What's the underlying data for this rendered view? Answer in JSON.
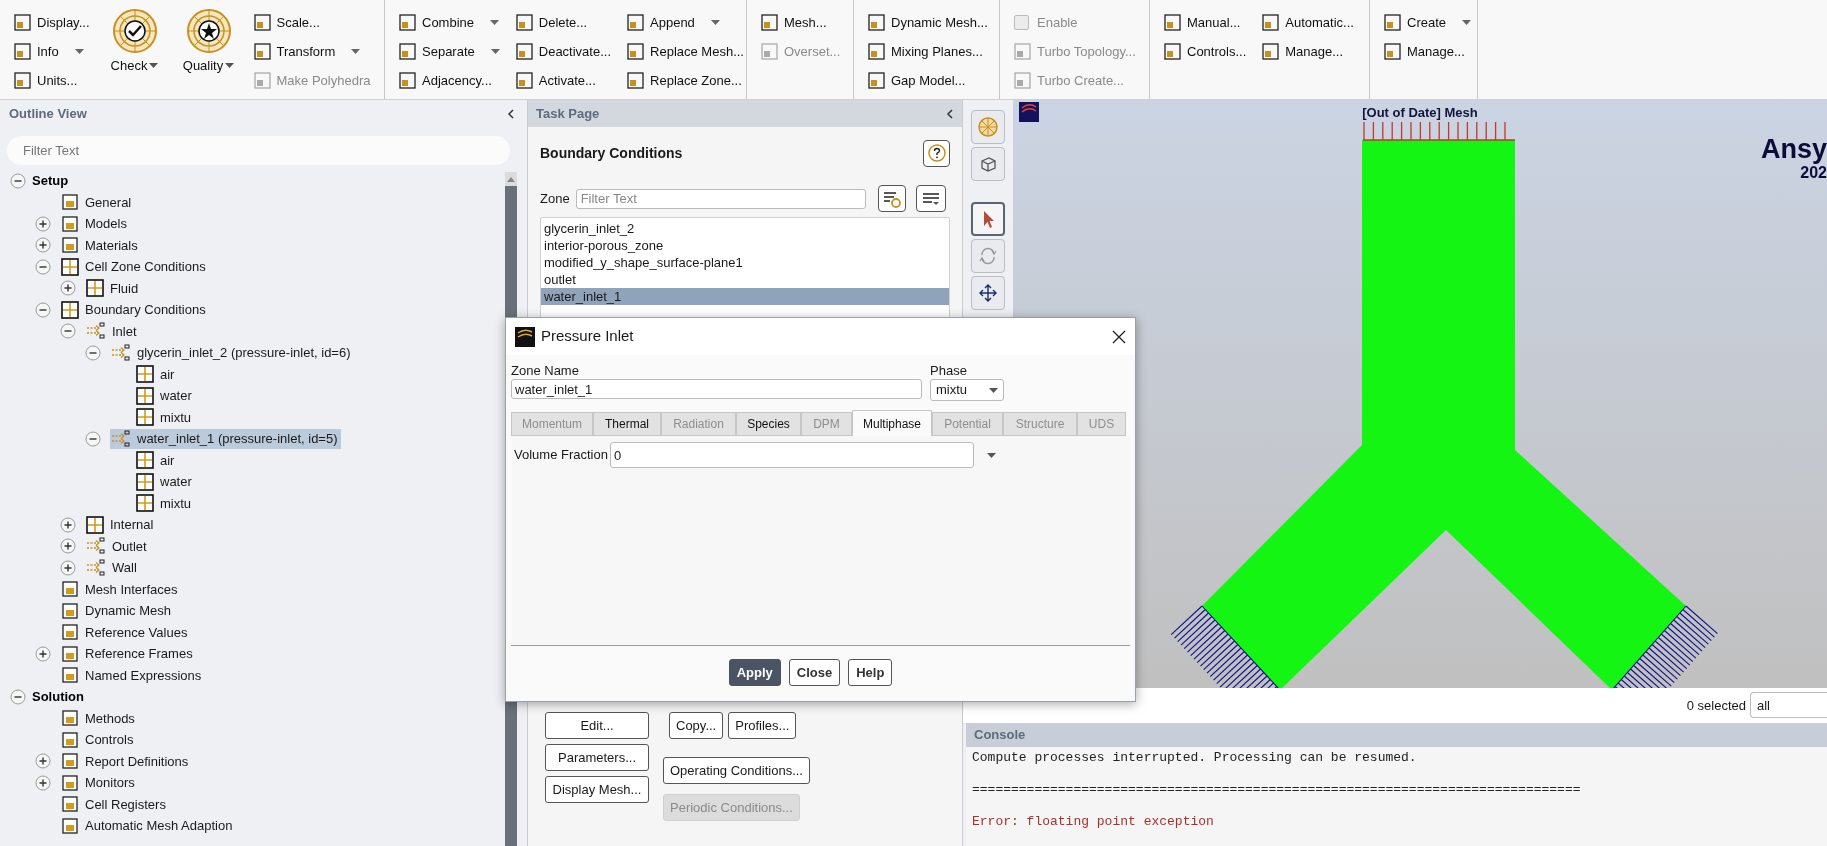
{
  "ribbon": [
    {
      "columns": [
        [
          {
            "kind": "small",
            "label": "Display...",
            "dropdown": false,
            "disabled": false
          },
          {
            "kind": "small",
            "label": "Info",
            "dropdown": true,
            "disabled": false
          },
          {
            "kind": "small",
            "label": "Units...",
            "dropdown": false,
            "disabled": false
          }
        ],
        [
          {
            "kind": "large",
            "label": "Check",
            "dropdown": true,
            "disabled": false
          }
        ],
        [
          {
            "kind": "large",
            "label": "Quality",
            "dropdown": true,
            "disabled": false
          }
        ],
        [
          {
            "kind": "small",
            "label": "Scale...",
            "dropdown": false,
            "disabled": false
          },
          {
            "kind": "small",
            "label": "Transform",
            "dropdown": true,
            "disabled": false
          },
          {
            "kind": "small",
            "label": "Make Polyhedra",
            "dropdown": false,
            "disabled": true
          }
        ]
      ]
    },
    {
      "columns": [
        [
          {
            "kind": "small",
            "label": "Combine",
            "dropdown": true,
            "disabled": false
          },
          {
            "kind": "small",
            "label": "Separate",
            "dropdown": true,
            "disabled": false
          },
          {
            "kind": "small",
            "label": "Adjacency...",
            "dropdown": false,
            "disabled": false
          }
        ],
        [
          {
            "kind": "small",
            "label": "Delete...",
            "dropdown": false,
            "disabled": false
          },
          {
            "kind": "small",
            "label": "Deactivate...",
            "dropdown": false,
            "disabled": false
          },
          {
            "kind": "small",
            "label": "Activate...",
            "dropdown": false,
            "disabled": false
          }
        ],
        [
          {
            "kind": "small",
            "label": "Append",
            "dropdown": true,
            "disabled": false
          },
          {
            "kind": "small",
            "label": "Replace Mesh...",
            "dropdown": false,
            "disabled": false
          },
          {
            "kind": "small",
            "label": "Replace Zone...",
            "dropdown": false,
            "disabled": false
          }
        ]
      ]
    },
    {
      "columns": [
        [
          {
            "kind": "small",
            "label": "Mesh...",
            "dropdown": false,
            "disabled": false
          },
          {
            "kind": "small",
            "label": "Overset...",
            "dropdown": false,
            "disabled": true
          }
        ]
      ]
    },
    {
      "columns": [
        [
          {
            "kind": "small",
            "label": "Dynamic Mesh...",
            "dropdown": false,
            "disabled": false
          },
          {
            "kind": "small",
            "label": "Mixing Planes...",
            "dropdown": false,
            "disabled": false
          },
          {
            "kind": "small",
            "label": "Gap Model...",
            "dropdown": false,
            "disabled": false
          }
        ]
      ]
    },
    {
      "columns": [
        [
          {
            "kind": "checkbox",
            "label": "Enable",
            "checked": false,
            "disabled": true
          },
          {
            "kind": "small",
            "label": "Turbo Topology...",
            "dropdown": false,
            "disabled": true
          },
          {
            "kind": "small",
            "label": "Turbo Create...",
            "dropdown": false,
            "disabled": true
          }
        ]
      ]
    },
    {
      "columns": [
        [
          {
            "kind": "small",
            "label": "Manual...",
            "dropdown": false,
            "disabled": false
          },
          {
            "kind": "small",
            "label": "Controls...",
            "dropdown": false,
            "disabled": false
          }
        ],
        [
          {
            "kind": "small",
            "label": "Automatic...",
            "dropdown": false,
            "disabled": false
          },
          {
            "kind": "small",
            "label": "Manage...",
            "dropdown": false,
            "disabled": false
          }
        ]
      ]
    },
    {
      "columns": [
        [
          {
            "kind": "small",
            "label": "Create",
            "dropdown": true,
            "disabled": false
          },
          {
            "kind": "small",
            "label": "Manage...",
            "dropdown": false,
            "disabled": false
          }
        ]
      ]
    }
  ],
  "outline": {
    "title": "Outline View",
    "filter_placeholder": "Filter Text",
    "tree": [
      {
        "label": "Setup",
        "kind": "section",
        "expanded": true,
        "selected": false,
        "children": [
          {
            "label": "General",
            "kind": "item",
            "selected": false
          },
          {
            "label": "Models",
            "kind": "item",
            "expanded": false,
            "selected": false
          },
          {
            "label": "Materials",
            "kind": "item",
            "expanded": false,
            "selected": false
          },
          {
            "label": "Cell Zone Conditions",
            "kind": "zone",
            "expanded": true,
            "selected": false,
            "children": [
              {
                "label": "Fluid",
                "kind": "zone",
                "expanded": false,
                "selected": false
              }
            ]
          },
          {
            "label": "Boundary Conditions",
            "kind": "zone",
            "expanded": true,
            "selected": false,
            "children": [
              {
                "label": "Inlet",
                "kind": "flow",
                "expanded": true,
                "selected": false,
                "children": [
                  {
                    "label": "glycerin_inlet_2 (pressure-inlet, id=6)",
                    "kind": "flow",
                    "expanded": true,
                    "selected": false,
                    "children": [
                      {
                        "label": "air",
                        "kind": "zone",
                        "selected": false
                      },
                      {
                        "label": "water",
                        "kind": "zone",
                        "selected": false
                      },
                      {
                        "label": "mixtu",
                        "kind": "zone",
                        "selected": false
                      }
                    ]
                  },
                  {
                    "label": "water_inlet_1 (pressure-inlet, id=5)",
                    "kind": "flow",
                    "expanded": true,
                    "selected": true,
                    "children": [
                      {
                        "label": "air",
                        "kind": "zone",
                        "selected": false
                      },
                      {
                        "label": "water",
                        "kind": "zone",
                        "selected": false
                      },
                      {
                        "label": "mixtu",
                        "kind": "zone",
                        "selected": false
                      }
                    ]
                  }
                ]
              },
              {
                "label": "Internal",
                "kind": "zone",
                "expanded": false,
                "selected": false
              },
              {
                "label": "Outlet",
                "kind": "flow",
                "expanded": false,
                "selected": false
              },
              {
                "label": "Wall",
                "kind": "flow",
                "expanded": false,
                "selected": false
              }
            ]
          },
          {
            "label": "Mesh Interfaces",
            "kind": "item",
            "selected": false
          },
          {
            "label": "Dynamic Mesh",
            "kind": "item",
            "selected": false
          },
          {
            "label": "Reference Values",
            "kind": "item",
            "selected": false
          },
          {
            "label": "Reference Frames",
            "kind": "item",
            "expanded": false,
            "selected": false
          },
          {
            "label": "Named Expressions",
            "kind": "item",
            "selected": false
          }
        ]
      },
      {
        "label": "Solution",
        "kind": "section",
        "expanded": true,
        "selected": false,
        "children": [
          {
            "label": "Methods",
            "kind": "item",
            "selected": false
          },
          {
            "label": "Controls",
            "kind": "item",
            "selected": false
          },
          {
            "label": "Report Definitions",
            "kind": "item",
            "expanded": false,
            "selected": false
          },
          {
            "label": "Monitors",
            "kind": "item",
            "expanded": false,
            "selected": false
          },
          {
            "label": "Cell Registers",
            "kind": "item",
            "selected": false
          },
          {
            "label": "Automatic Mesh Adaption",
            "kind": "item",
            "selected": false
          }
        ]
      }
    ]
  },
  "task_page": {
    "header": "Task Page",
    "title": "Boundary Conditions",
    "zone_label": "Zone",
    "zone_filter_placeholder": "Filter Text",
    "zones": [
      {
        "label": "glycerin_inlet_2",
        "selected": false
      },
      {
        "label": "interior-porous_zone",
        "selected": false
      },
      {
        "label": "modified_y_shape_surface-plane1",
        "selected": false
      },
      {
        "label": "outlet",
        "selected": false
      },
      {
        "label": "water_inlet_1",
        "selected": true
      }
    ],
    "buttons_left": [
      {
        "label": "Edit...",
        "disabled": false
      },
      {
        "label": "Parameters...",
        "disabled": false
      },
      {
        "label": "Display Mesh...",
        "disabled": false
      }
    ],
    "buttons_right": [
      [
        {
          "label": "Copy...",
          "disabled": false
        },
        {
          "label": "Profiles...",
          "disabled": false
        }
      ],
      [
        {
          "label": "Operating Conditions...",
          "disabled": false
        }
      ],
      [
        {
          "label": "Periodic Conditions...",
          "disabled": true
        }
      ]
    ]
  },
  "graphics_toolbar": [
    {
      "selected": false
    },
    {
      "selected": false
    },
    {
      "selected": true
    },
    {
      "selected": false
    },
    {
      "selected": false
    }
  ],
  "graphics": {
    "title": "[Out of Date] Mesh",
    "brand": "Ansy",
    "version": "202"
  },
  "selection_bar": {
    "count": "0 selected",
    "filter": "all"
  },
  "console": {
    "title": "Console",
    "lines": [
      {
        "kind": "info",
        "text": "Compute processes interrupted. Processing can be resumed."
      },
      {
        "kind": "info",
        "text": "=============================================================================="
      },
      {
        "kind": "error",
        "text": "Error: floating point exception"
      }
    ]
  },
  "dialog": {
    "title": "Pressure Inlet",
    "zone_name_label": "Zone Name",
    "zone_name": "water_inlet_1",
    "phase_label": "Phase",
    "phase": "mixtu",
    "tabs": [
      {
        "label": "Momentum",
        "selected": false,
        "disabled": true
      },
      {
        "label": "Thermal",
        "selected": false,
        "disabled": false
      },
      {
        "label": "Radiation",
        "selected": false,
        "disabled": true
      },
      {
        "label": "Species",
        "selected": false,
        "disabled": false
      },
      {
        "label": "DPM",
        "selected": false,
        "disabled": true
      },
      {
        "label": "Multiphase",
        "selected": true,
        "disabled": false
      },
      {
        "label": "Potential",
        "selected": false,
        "disabled": true
      },
      {
        "label": "Structure",
        "selected": false,
        "disabled": true
      },
      {
        "label": "UDS",
        "selected": false,
        "disabled": true
      }
    ],
    "fields": [
      {
        "label": "Volume Fraction",
        "value": "0"
      }
    ],
    "buttons": [
      {
        "label": "Apply",
        "kind": "primary"
      },
      {
        "label": "Close",
        "kind": "normal"
      },
      {
        "label": "Help",
        "kind": "normal"
      }
    ]
  }
}
